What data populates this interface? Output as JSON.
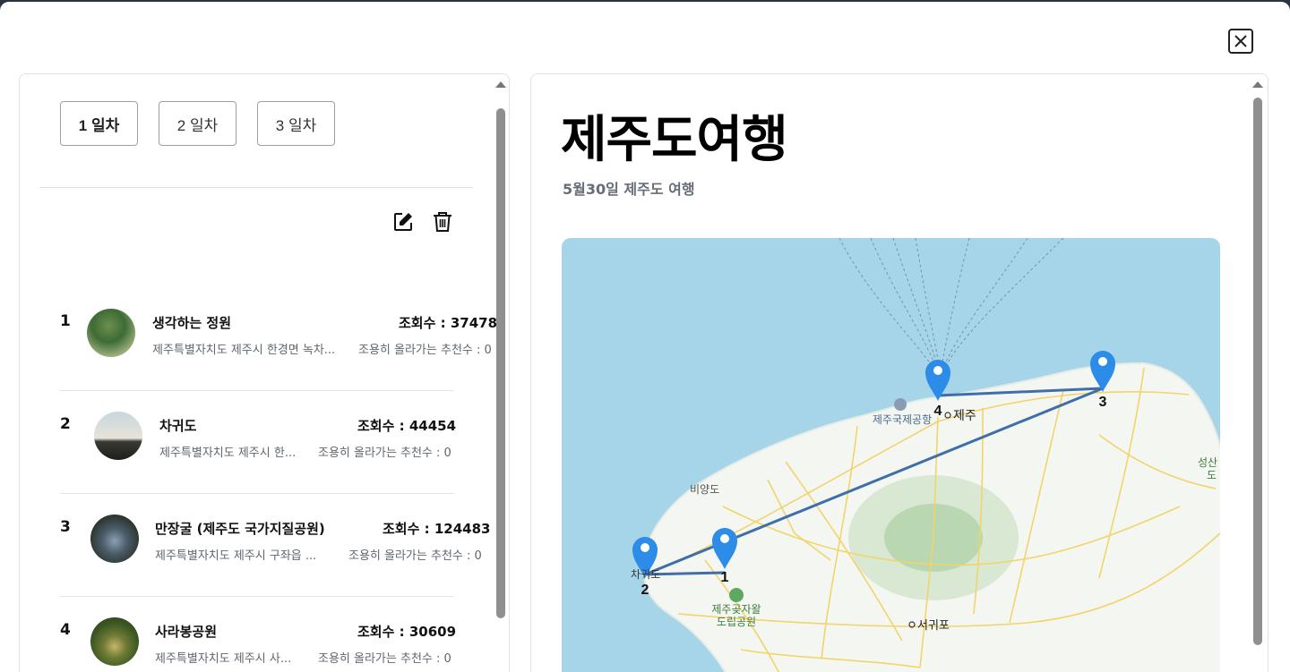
{
  "close_icon": "close-icon",
  "days": [
    {
      "label": "1 일차"
    },
    {
      "label": "2 일차"
    },
    {
      "label": "3 일차"
    }
  ],
  "toolbar": {
    "edit_icon": "edit-icon",
    "delete_icon": "trash-icon"
  },
  "places": [
    {
      "num": "1",
      "name": "생각하는 정원",
      "address": "제주특별자치도 제주시 한경면 녹차...",
      "views": "조회수 : 37478",
      "recommend": "조용히 올라가는 추천수 : 0"
    },
    {
      "num": "2",
      "name": "차귀도",
      "address": "제주특별자치도 제주시 한...",
      "views": "조회수 : 44454",
      "recommend": "조용히 올라가는 추천수 : 0"
    },
    {
      "num": "3",
      "name": "만장굴 (제주도 국가지질공원)",
      "address": "제주특별자치도 제주시 구좌읍 ...",
      "views": "조회수 : 124483",
      "recommend": "조용히 올라가는 추천수 : 0"
    },
    {
      "num": "4",
      "name": "사라봉공원",
      "address": "제주특별자치도 제주시 사...",
      "views": "조회수 : 30609",
      "recommend": "조용히 올라가는 추천수 : 0"
    }
  ],
  "trip": {
    "title": "제주도여행",
    "subtitle": "5월30일 제주도 여행"
  },
  "map": {
    "labels": {
      "airport": "제주국제공항",
      "jeju": "제주",
      "biyangdo": "비양도",
      "seogwipo": "서귀포",
      "park_line1": "제주곶자왈",
      "park_line2": "도립공원",
      "chagwido": "차귀도",
      "seongsan_1": "성산",
      "seongsan_2": "도"
    },
    "markers": [
      {
        "label": "1"
      },
      {
        "label": "2"
      },
      {
        "label": "3"
      },
      {
        "label": "4"
      }
    ],
    "colors": {
      "water": "#a6d5ea",
      "land": "#f4f6f2",
      "route": "#3f6fa8",
      "marker": "#2d8ce8",
      "road": "#f2d46b"
    }
  }
}
